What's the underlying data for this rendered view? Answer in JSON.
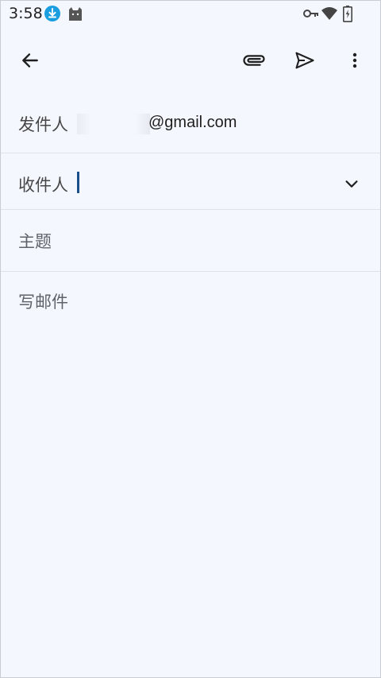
{
  "status_bar": {
    "time": "3:58",
    "icons": [
      "download-icon",
      "cat-app-icon",
      "vpn-key-icon",
      "wifi-icon",
      "battery-icon"
    ]
  },
  "app_bar": {
    "actions": [
      "back-icon",
      "attach-icon",
      "send-icon",
      "more-vert-icon"
    ]
  },
  "compose": {
    "from_label": "发件人",
    "from_value": "@gmail.com",
    "to_label": "收件人",
    "subject_placeholder": "主题",
    "body_placeholder": "写邮件"
  },
  "colors": {
    "background": "#f4f7fe",
    "accent_download": "#1a9ee0",
    "caret": "#1a4f8b"
  }
}
